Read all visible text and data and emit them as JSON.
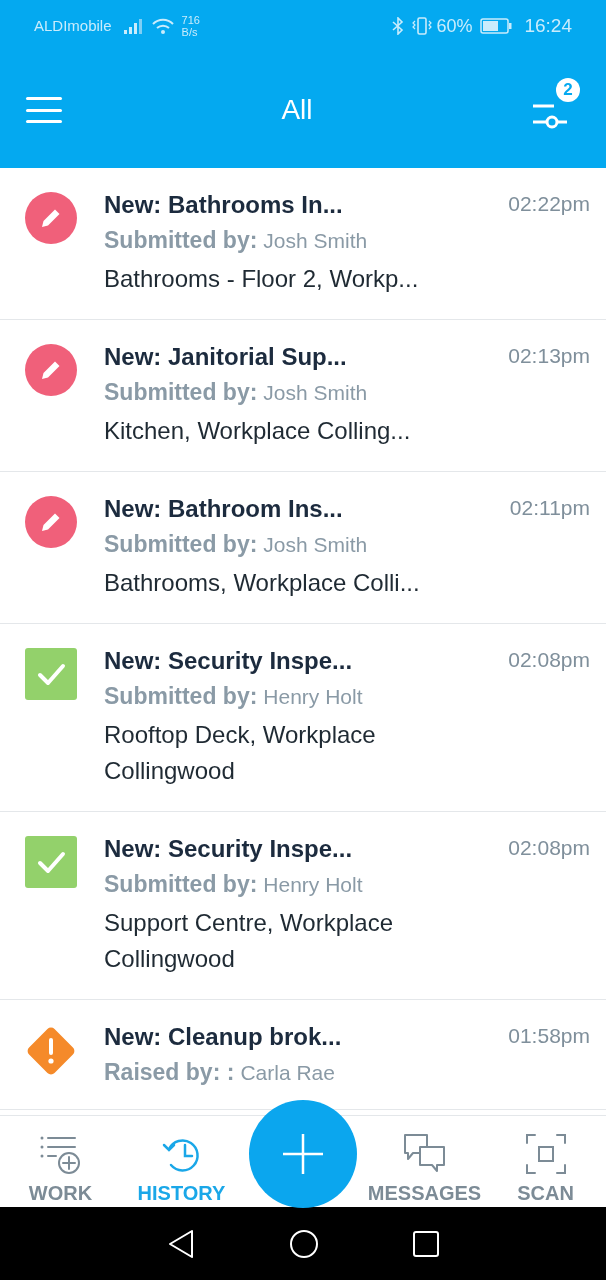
{
  "status_bar": {
    "carrier": "ALDImobile",
    "speed_value": "716",
    "speed_unit": "B/s",
    "battery": "60%",
    "time": "16:24"
  },
  "app_bar": {
    "title": "All",
    "filter_count": "2"
  },
  "items": [
    {
      "kind": "draft",
      "title": "New: Bathrooms In...",
      "time": "02:22pm",
      "by_label": "Submitted by:",
      "by_name": "Josh Smith",
      "location": "Bathrooms - Floor 2, Workp..."
    },
    {
      "kind": "draft",
      "title": "New: Janitorial Sup...",
      "time": "02:13pm",
      "by_label": "Submitted by:",
      "by_name": "Josh Smith",
      "location": "Kitchen, Workplace Colling..."
    },
    {
      "kind": "draft",
      "title": "New: Bathroom Ins...",
      "time": "02:11pm",
      "by_label": "Submitted by:",
      "by_name": "Josh Smith",
      "location": "Bathrooms, Workplace Colli..."
    },
    {
      "kind": "done",
      "title": "New: Security Inspe...",
      "time": "02:08pm",
      "by_label": "Submitted by:",
      "by_name": "Henry Holt",
      "location": "Rooftop Deck, Workplace Collingwood"
    },
    {
      "kind": "done",
      "title": "New: Security Inspe...",
      "time": "02:08pm",
      "by_label": "Submitted by:",
      "by_name": "Henry Holt",
      "location": "Support Centre, Workplace Collingwood"
    },
    {
      "kind": "issue",
      "title": "New: Cleanup brok...",
      "time": "01:58pm",
      "by_label": "Raised by: :",
      "by_name": "Carla Rae"
    }
  ],
  "nav": [
    {
      "kind": "work",
      "label": "WORK",
      "selected": false
    },
    {
      "kind": "history",
      "label": "HISTORY",
      "selected": true
    },
    {
      "kind": "messages",
      "label": "MESSAGES",
      "selected": false
    },
    {
      "kind": "scan",
      "label": "SCAN",
      "selected": false
    }
  ]
}
